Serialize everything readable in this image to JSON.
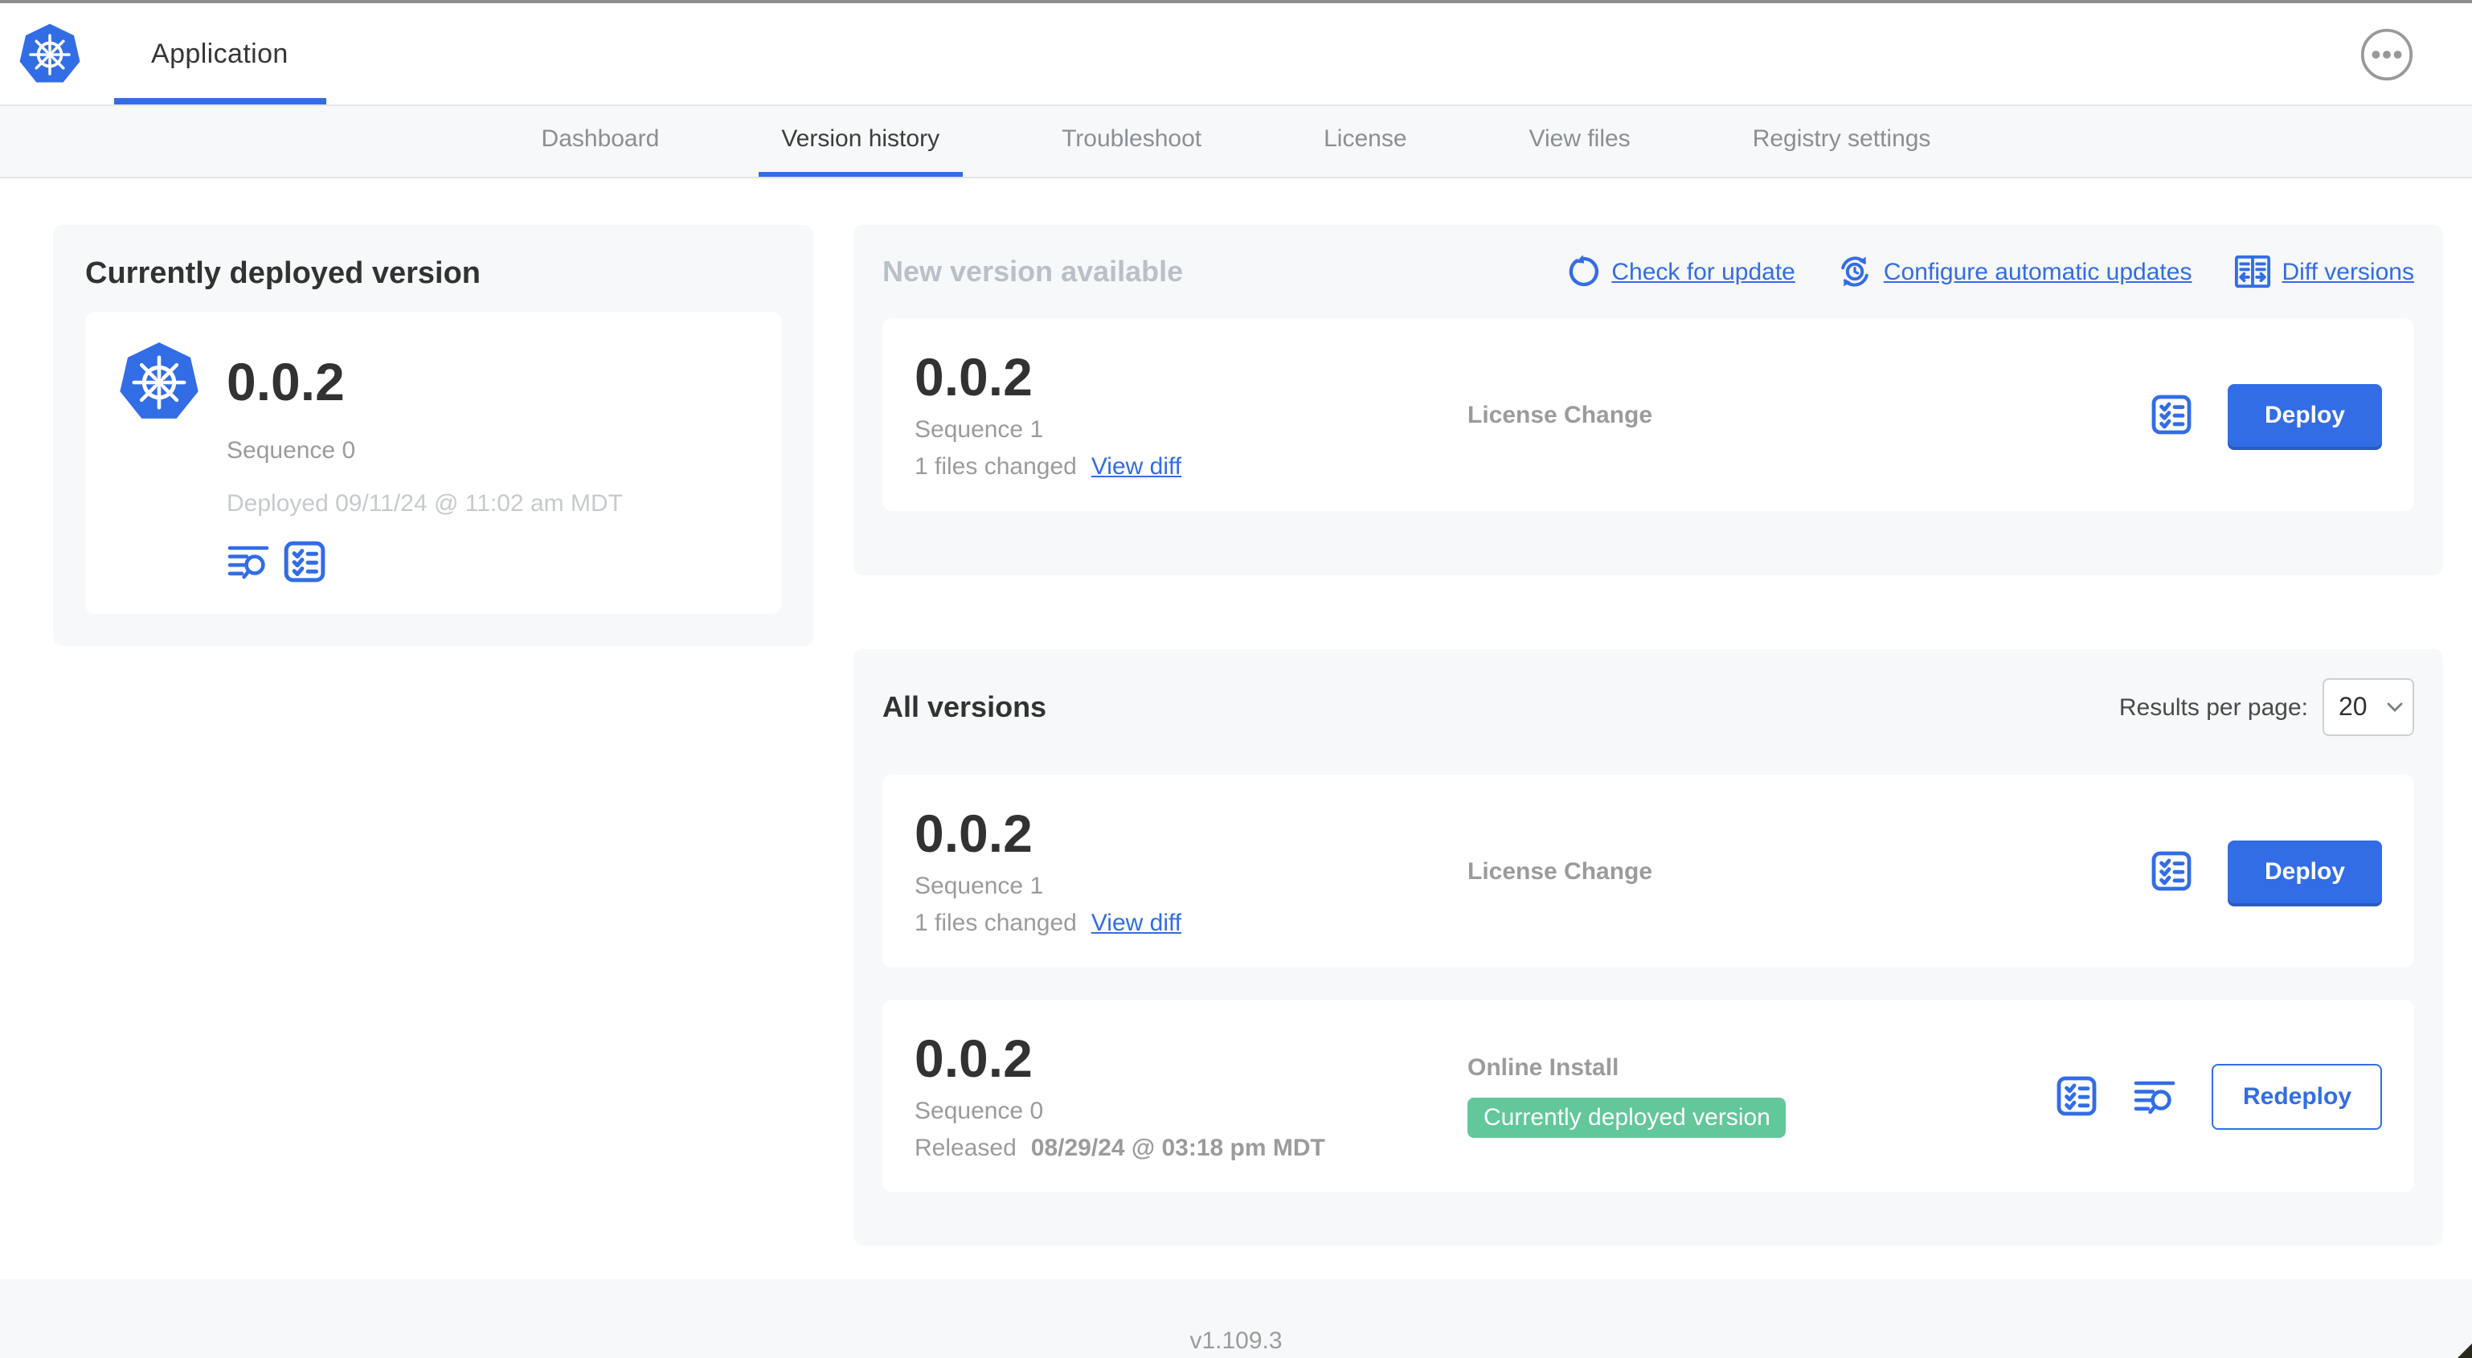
{
  "header": {
    "app_title": "Application"
  },
  "nav": {
    "tabs": [
      {
        "label": "Dashboard",
        "active": false
      },
      {
        "label": "Version history",
        "active": true
      },
      {
        "label": "Troubleshoot",
        "active": false
      },
      {
        "label": "License",
        "active": false
      },
      {
        "label": "View files",
        "active": false
      },
      {
        "label": "Registry settings",
        "active": false
      }
    ]
  },
  "current_version": {
    "title": "Currently deployed version",
    "version": "0.0.2",
    "sequence": "Sequence 0",
    "deployed": "Deployed 09/11/24 @ 11:02 am MDT"
  },
  "new_version": {
    "title": "New version available",
    "actions": [
      {
        "label": "Check for update",
        "icon": "refresh-circular-arrow"
      },
      {
        "label": "Configure automatic updates",
        "icon": "sync-clock"
      },
      {
        "label": "Diff versions",
        "icon": "split-columns-diff"
      }
    ],
    "card": {
      "version": "0.0.2",
      "sequence": "Sequence 1",
      "files_changed": "1 files changed",
      "view_diff_label": "View diff",
      "source": "License Change",
      "action_label": "Deploy"
    }
  },
  "all_versions": {
    "title": "All versions",
    "results_per_page_label": "Results per page:",
    "results_per_page_value": "20",
    "rows": [
      {
        "version": "0.0.2",
        "sequence": "Sequence 1",
        "files_changed": "1 files changed",
        "view_diff_label": "View diff",
        "source": "License Change",
        "action_label": "Deploy"
      },
      {
        "version": "0.0.2",
        "sequence": "Sequence 0",
        "released_prefix": "Released",
        "released_date": "08/29/24 @ 03:18 pm MDT",
        "source": "Online Install",
        "badge": "Currently deployed version",
        "action_label": "Redeploy"
      }
    ]
  },
  "footer": {
    "app_manager_version": "v1.109.3"
  },
  "colors": {
    "accent_blue": "#326de6",
    "badge_green": "#62c79a",
    "text_dark": "#323232",
    "text_gray": "#9b9b9b",
    "text_light_gray": "#c6cacc",
    "panel_bg": "#f6f8f9"
  },
  "icons": {
    "app_logo": "kubernetes-wheel-heptagon",
    "header_menu": "ellipsis-in-circle",
    "preflight_checks": "checklist-box",
    "deploy_logs": "lines-with-magnifier",
    "check_for_update": "circular-arrow",
    "configure_auto_updates": "sync-arrows-clock",
    "diff_versions": "split-panes-arrows",
    "select_chevron": "chevron-down"
  }
}
